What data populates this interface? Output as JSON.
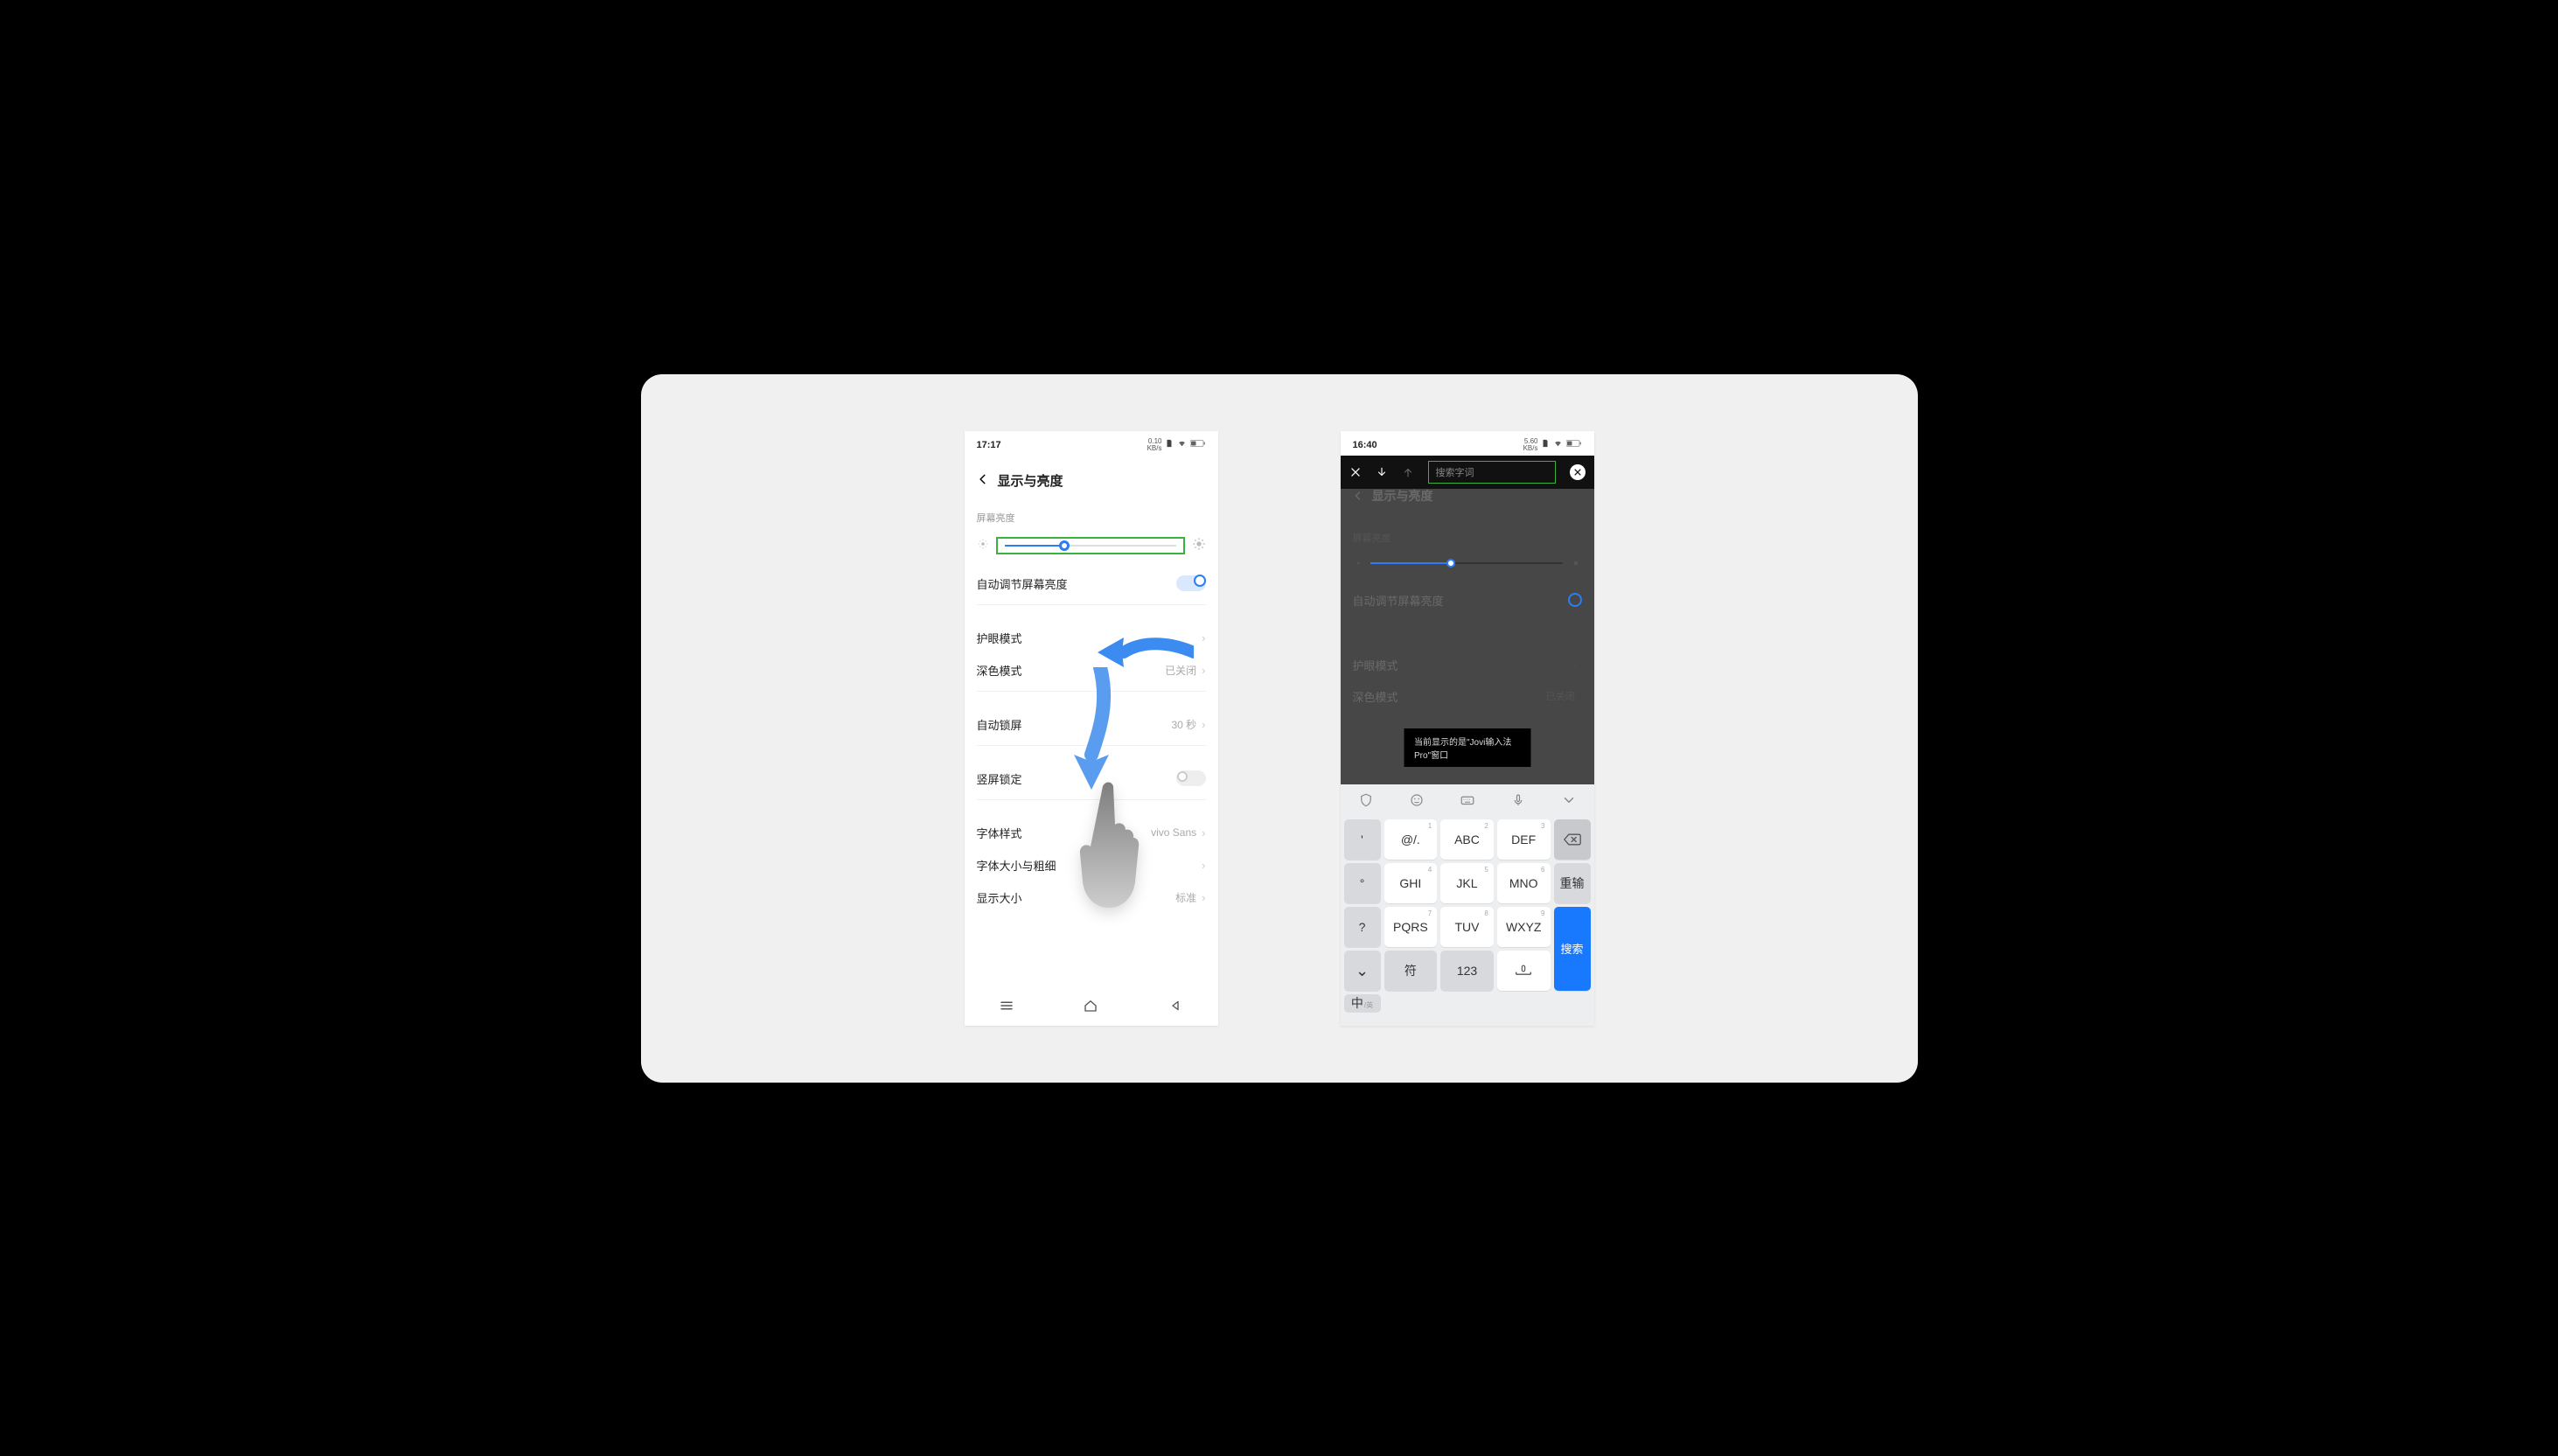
{
  "left": {
    "status": {
      "time": "17:17",
      "net_rate": "0.10",
      "net_unit": "KB/s"
    },
    "title": "显示与亮度",
    "section_brightness_label": "屏幕亮度",
    "auto_brightness": "自动调节屏幕亮度",
    "eye_mode": "护眼模式",
    "dark_mode": "深色模式",
    "dark_mode_value": "已关闭",
    "auto_lock": "自动锁屏",
    "auto_lock_value": "30 秒",
    "rotation_lock": "竖屏锁定",
    "font_style": "字体样式",
    "font_style_value": "vivo Sans",
    "font_size_weight": "字体大小与粗细",
    "display_size": "显示大小",
    "display_size_value": "标准"
  },
  "right": {
    "status": {
      "time": "16:40",
      "net_rate": "5.60",
      "net_unit": "KB/s"
    },
    "search_placeholder": "搜索字词",
    "title": "显示与亮度",
    "section_brightness_label": "屏幕亮度",
    "auto_brightness": "自动调节屏幕亮度",
    "eye_mode": "护眼模式",
    "dark_mode": "深色模式",
    "dark_mode_value": "已关闭",
    "toast": "当前显示的是\"Jovi输入法Pro\"窗口",
    "keys": {
      "punct1": "'",
      "at": "@/.",
      "abc": "ABC",
      "def": "DEF",
      "bksp": "⌫",
      "punct2": "°",
      "ghi": "GHI",
      "jkl": "JKL",
      "mno": "MNO",
      "retype": "重输",
      "punct3": "?",
      "pqrs": "PQRS",
      "tuv": "TUV",
      "wxyz": "WXYZ",
      "search": "搜索",
      "chevdown": "⌄",
      "sym": "符",
      "num": "123",
      "lang_main": "中",
      "lang_sub": "/英"
    }
  }
}
